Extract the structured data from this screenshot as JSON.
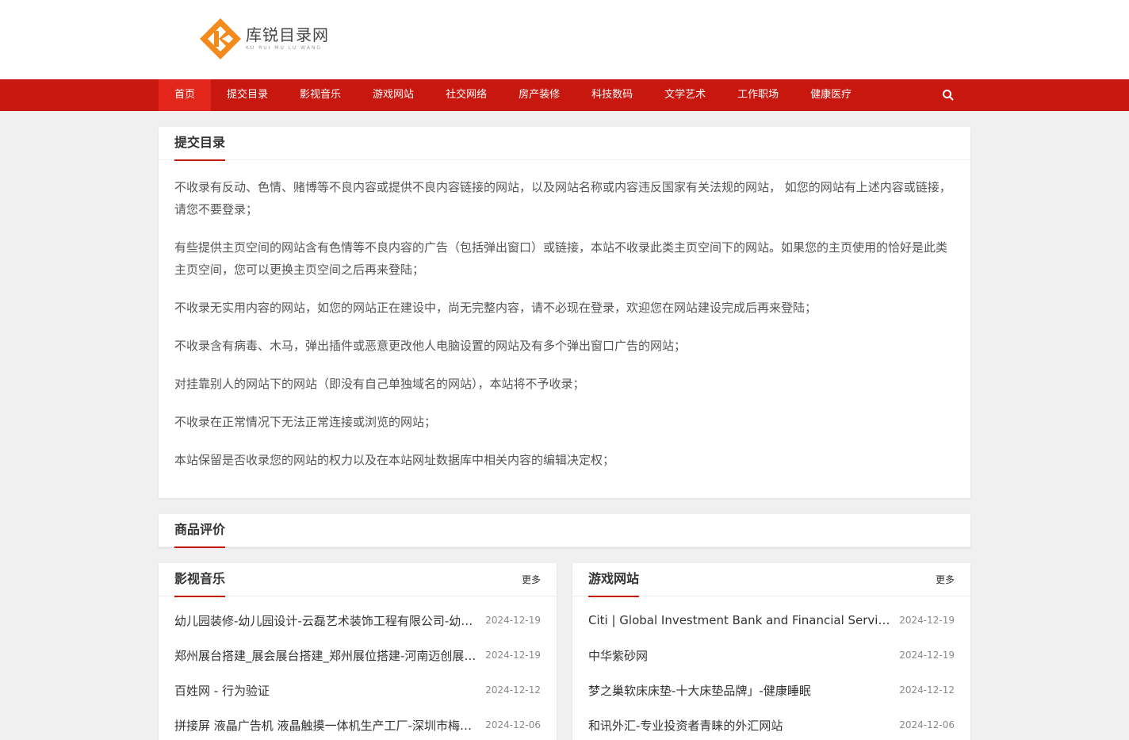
{
  "brand": {
    "name_cn": "库锐目录网",
    "name_en": "KU RUI MU LU WANG",
    "accent": "#c8170f",
    "logo_orange": "#f28a1e"
  },
  "nav": {
    "items": [
      "首页",
      "提交目录",
      "影视音乐",
      "游戏网站",
      "社交网络",
      "房产装修",
      "科技数码",
      "文学艺术",
      "工作职场",
      "健康医疗"
    ],
    "active_index": 0,
    "search_icon": "search-icon"
  },
  "submit": {
    "title": "提交目录",
    "rules": [
      "不收录有反动、色情、赌博等不良内容或提供不良内容链接的网站，以及网站名称或内容违反国家有关法规的网站， 如您的网站有上述内容或链接，请您不要登录；",
      "有些提供主页空间的网站含有色情等不良内容的广告（包括弹出窗口）或链接，本站不收录此类主页空间下的网站。如果您的主页使用的恰好是此类主页空间，您可以更换主页空间之后再来登陆；",
      "不收录无实用内容的网站，如您的网站正在建设中，尚无完整内容，请不必现在登录，欢迎您在网站建设完成后再来登陆；",
      "不收录含有病毒、木马，弹出插件或恶意更改他人电脑设置的网站及有多个弹出窗口广告的网站；",
      "对挂靠别人的网站下的网站（即没有自己单独域名的网站），本站将不予收录；",
      "不收录在正常情况下无法正常连接或浏览的网站；",
      "本站保留是否收录您的网站的权力以及在本站网址数据库中相关内容的编辑决定权；"
    ]
  },
  "reviews": {
    "title": "商品评价"
  },
  "col_left": {
    "title": "影视音乐",
    "more": "更多",
    "items": [
      {
        "title": "幼儿园装修-幼儿园设计-云磊艺术装饰工程有限公司-幼儿园装修设计",
        "date": "2024-12-19"
      },
      {
        "title": "郑州展台搭建_展会展台搭建_郑州展位搭建-河南迈创展览展示",
        "date": "2024-12-19"
      },
      {
        "title": "百姓网 - 行为验证",
        "date": "2024-12-12"
      },
      {
        "title": "拼接屏 液晶广告机 液晶触摸一体机生产工厂-深圳市梅花显示科技",
        "date": "2024-12-06"
      }
    ]
  },
  "col_right": {
    "title": "游戏网站",
    "more": "更多",
    "items": [
      {
        "title": "Citi | Global Investment Bank and Financial Services",
        "date": "2024-12-19"
      },
      {
        "title": "中华紫砂网",
        "date": "2024-12-19"
      },
      {
        "title": "梦之巢软床床垫-十大床垫品牌」-健康睡眠",
        "date": "2024-12-12"
      },
      {
        "title": "和讯外汇-专业投资者青睐的外汇网站",
        "date": "2024-12-06"
      }
    ]
  }
}
